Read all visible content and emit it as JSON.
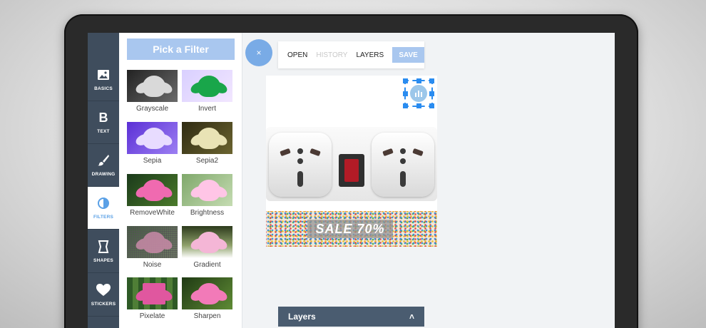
{
  "sidebar": {
    "tools": [
      {
        "label": "BASICS",
        "icon": "image-icon"
      },
      {
        "label": "TEXT",
        "icon": "bold-icon",
        "glyph": "B"
      },
      {
        "label": "DRAWING",
        "icon": "brush-icon"
      },
      {
        "label": "FILTERS",
        "icon": "filter-icon",
        "active": true
      },
      {
        "label": "SHAPES",
        "icon": "shape-icon"
      },
      {
        "label": "STICKERS",
        "icon": "heart-icon"
      }
    ]
  },
  "filters_panel": {
    "title": "Pick a Filter",
    "filters": [
      {
        "name": "Grayscale"
      },
      {
        "name": "Invert"
      },
      {
        "name": "Sepia"
      },
      {
        "name": "Sepia2"
      },
      {
        "name": "RemoveWhite"
      },
      {
        "name": "Brightness"
      },
      {
        "name": "Noise"
      },
      {
        "name": "Gradient"
      },
      {
        "name": "Pixelate"
      },
      {
        "name": "Sharpen"
      }
    ]
  },
  "toolbar": {
    "close_glyph": "×",
    "open": "OPEN",
    "history": "HISTORY",
    "layers": "LAYERS",
    "save": "SAVE"
  },
  "canvas": {
    "sale_text": "SALE 70%"
  },
  "layers_panel": {
    "title": "Layers",
    "chevron": "˄"
  },
  "window": {
    "close_glyph": "✕"
  },
  "colors": {
    "accent": "#79abe6",
    "sidebar": "#3f4d5d",
    "button": "#a9c7ef"
  }
}
